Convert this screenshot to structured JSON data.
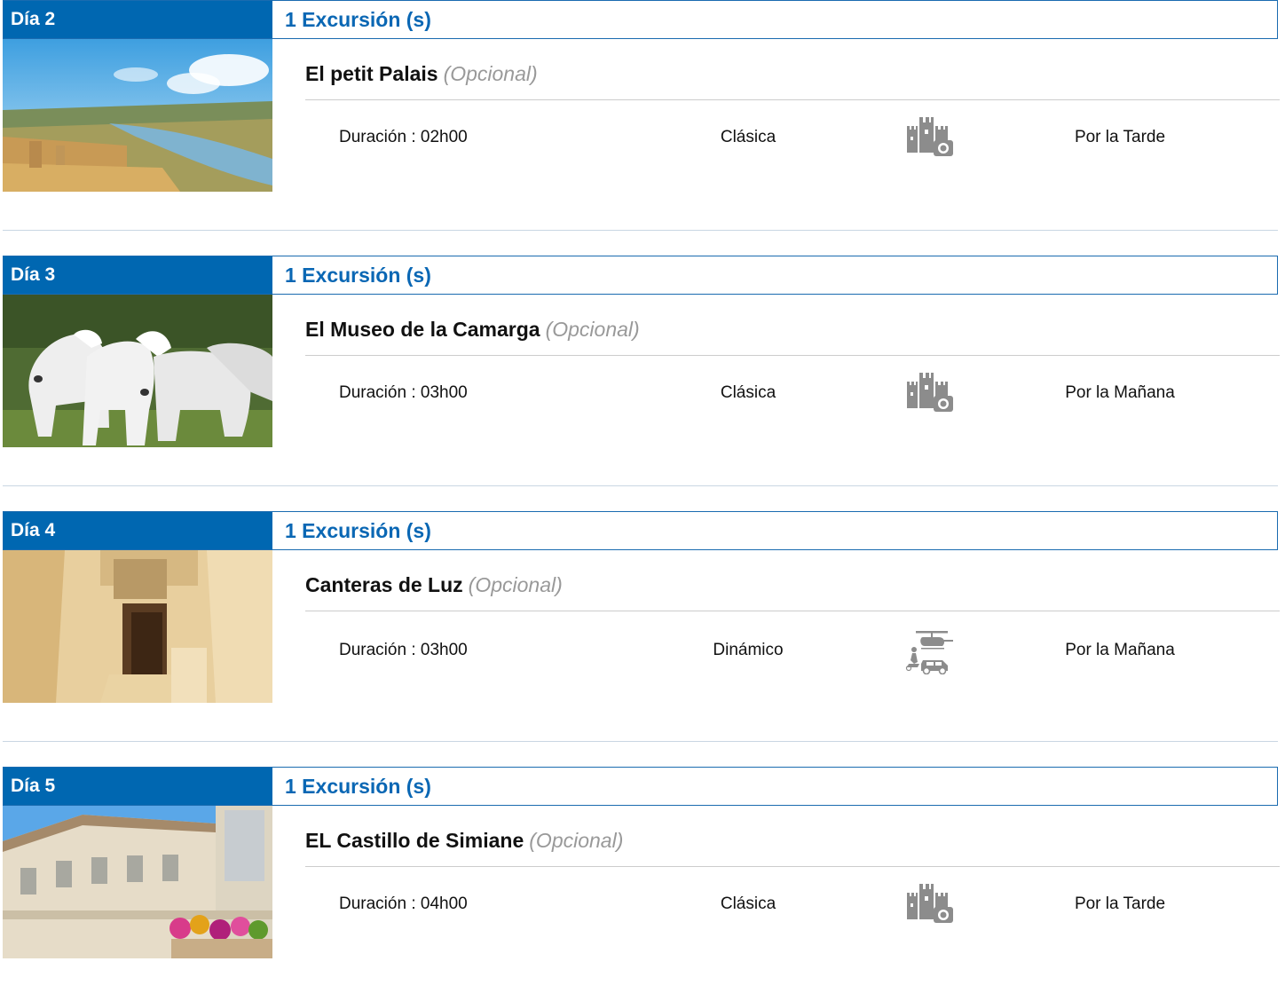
{
  "days": [
    {
      "day_label": "Día 2",
      "excursion_count": "1 Excursión (s)",
      "title": "El petit Palais",
      "optional": "(Opcional)",
      "duration": "Duración : 02h00",
      "style": "Clásica",
      "style_icon": "castle-camera-icon",
      "period": "Por la Tarde",
      "image": "river-city-aerial"
    },
    {
      "day_label": "Día 3",
      "excursion_count": "1 Excursión (s)",
      "title": "El Museo de la Camarga",
      "optional": "(Opcional)",
      "duration": "Duración : 03h00",
      "style": "Clásica",
      "style_icon": "castle-camera-icon",
      "period": "Por la Mañana",
      "image": "white-horses"
    },
    {
      "day_label": "Día 4",
      "excursion_count": "1 Excursión (s)",
      "title": "Canteras de Luz",
      "optional": "(Opcional)",
      "duration": "Duración : 03h00",
      "style": "Dinámico",
      "style_icon": "helicopter-car-icon",
      "period": "Por la Mañana",
      "image": "stone-quarry"
    },
    {
      "day_label": "Día 5",
      "excursion_count": "1 Excursión (s)",
      "title": "EL Castillo de Simiane",
      "optional": "(Opcional)",
      "duration": "Duración : 04h00",
      "style": "Clásica",
      "style_icon": "castle-camera-icon",
      "period": "Por la Tarde",
      "image": "chateau-facade"
    }
  ],
  "colors": {
    "accent": "#0067b1",
    "accent_text": "#0a67b4",
    "muted": "#999999"
  }
}
